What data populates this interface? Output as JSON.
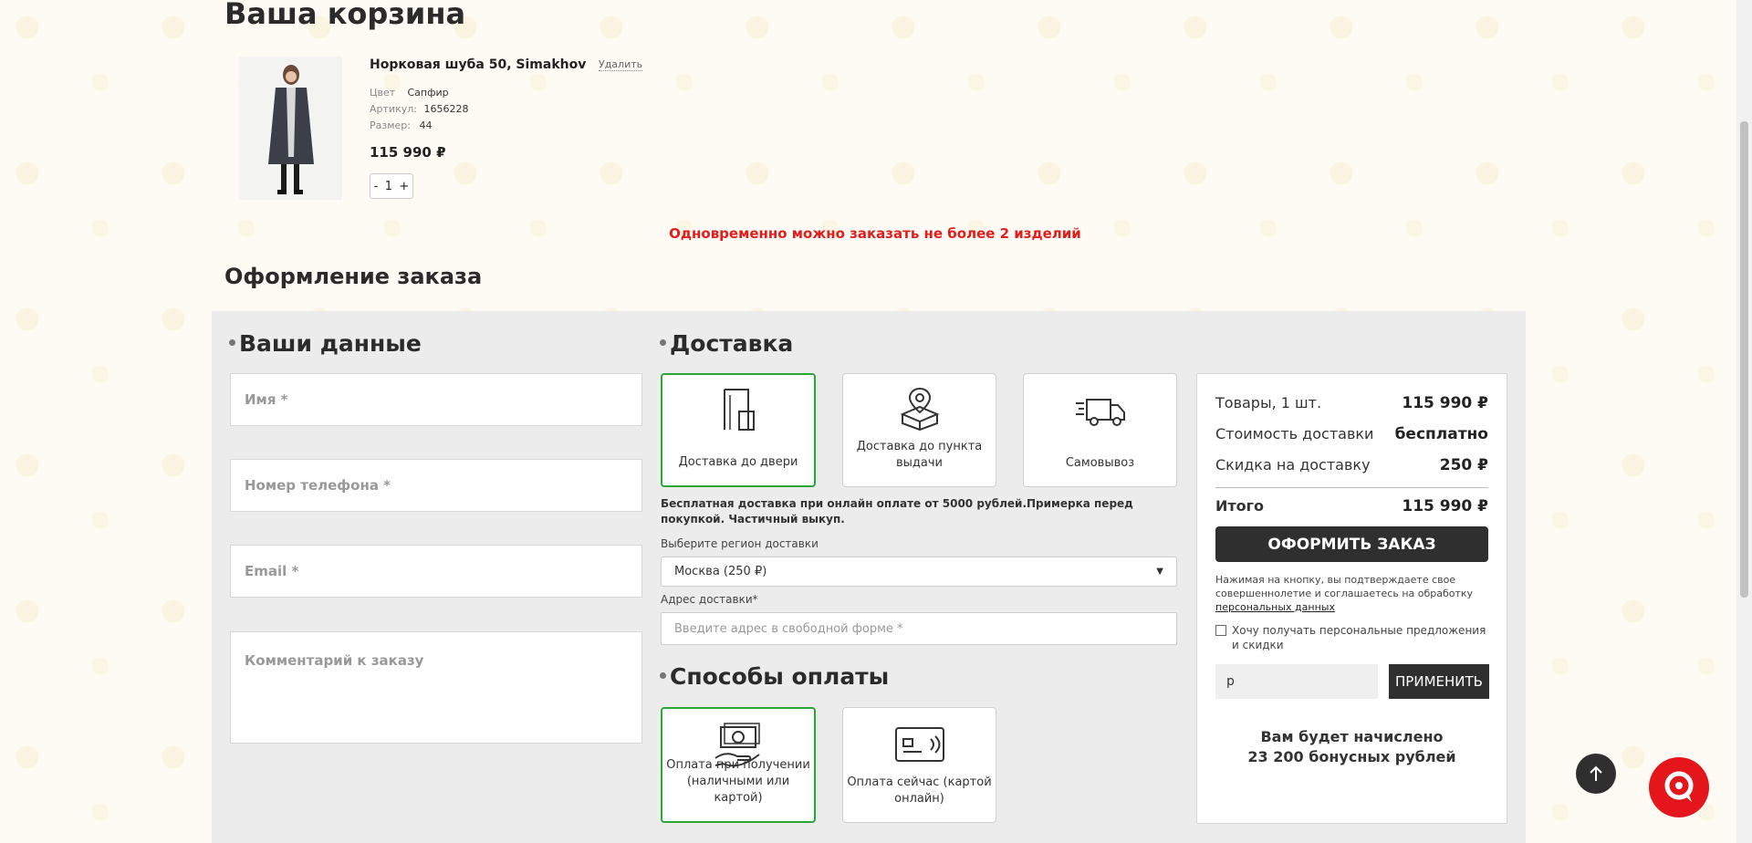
{
  "cart": {
    "title": "Ваша корзина",
    "item": {
      "name": "Норковая шуба 50, Simakhov",
      "remove_label": "Удалить",
      "attrs": [
        {
          "key": "Цвет",
          "value": "Сапфир"
        },
        {
          "key": "Артикул:",
          "value": "1656228"
        },
        {
          "key": "Размер:",
          "value": "44"
        }
      ],
      "price": "115 990 ₽",
      "qty_minus": "-",
      "qty_value": "1",
      "qty_plus": "+"
    },
    "limit_message": "Одновременно можно заказать не более 2 изделий"
  },
  "checkout": {
    "title": "Оформление заказа",
    "customer": {
      "section_title": "Ваши данные",
      "name_placeholder": "Имя *",
      "phone_placeholder": "Номер телефона *",
      "email_placeholder": "Email *",
      "comment_placeholder": "Комментарий к заказу"
    },
    "delivery": {
      "section_title": "Доставка",
      "options": [
        {
          "label": "Доставка до двери",
          "icon": "door-icon",
          "selected": true
        },
        {
          "label": "Доставка до пункта выдачи",
          "icon": "pickup-point-icon",
          "selected": false
        },
        {
          "label": "Самовывоз",
          "icon": "truck-icon",
          "selected": false
        }
      ],
      "note": "Бесплатная доставка при онлайн оплате от 5000 рублей.Примерка перед покупкой. Частичный выкуп.",
      "region_label": "Выберите регион доставки",
      "region_value": "Москва (250 ₽)",
      "address_label": "Адрес доставки*",
      "address_placeholder": "Введите адрес в свободной форме *"
    },
    "payment": {
      "section_title": "Способы оплаты",
      "options": [
        {
          "label": "Оплата при получении (наличными или картой)",
          "icon": "cash-hand-icon",
          "selected": true
        },
        {
          "label": "Оплата сейчас (картой онлайн)",
          "icon": "card-icon",
          "selected": false
        }
      ]
    }
  },
  "summary": {
    "goods_label": "Товары, 1 шт.",
    "goods_value": "115 990 ₽",
    "delivery_label": "Стоимость доставки",
    "delivery_value": "бесплатно",
    "discount_label": "Скидка на доставку",
    "discount_value": "250 ₽",
    "total_label": "Итого",
    "total_value": "115 990 ₽",
    "order_button": "ОФОРМИТЬ ЗАКАЗ",
    "legal_text": "Нажимая на кнопку, вы подтверждаете свое совершеннолетие и соглашаетесь на обработку",
    "legal_link": "персональных данных",
    "offers_checkbox_label": "Хочу получать персональные предложения и скидки",
    "promo_value": "р",
    "apply_button": "ПРИМЕНИТЬ",
    "bonus_line1": "Вам будет начислено",
    "bonus_line2": "23 200 бонусных рублей"
  },
  "colors": {
    "accent_green": "#2aa836",
    "alert_red": "#e41c1c",
    "dark_button": "#2f2f2f",
    "chat_red": "#e4161c"
  }
}
